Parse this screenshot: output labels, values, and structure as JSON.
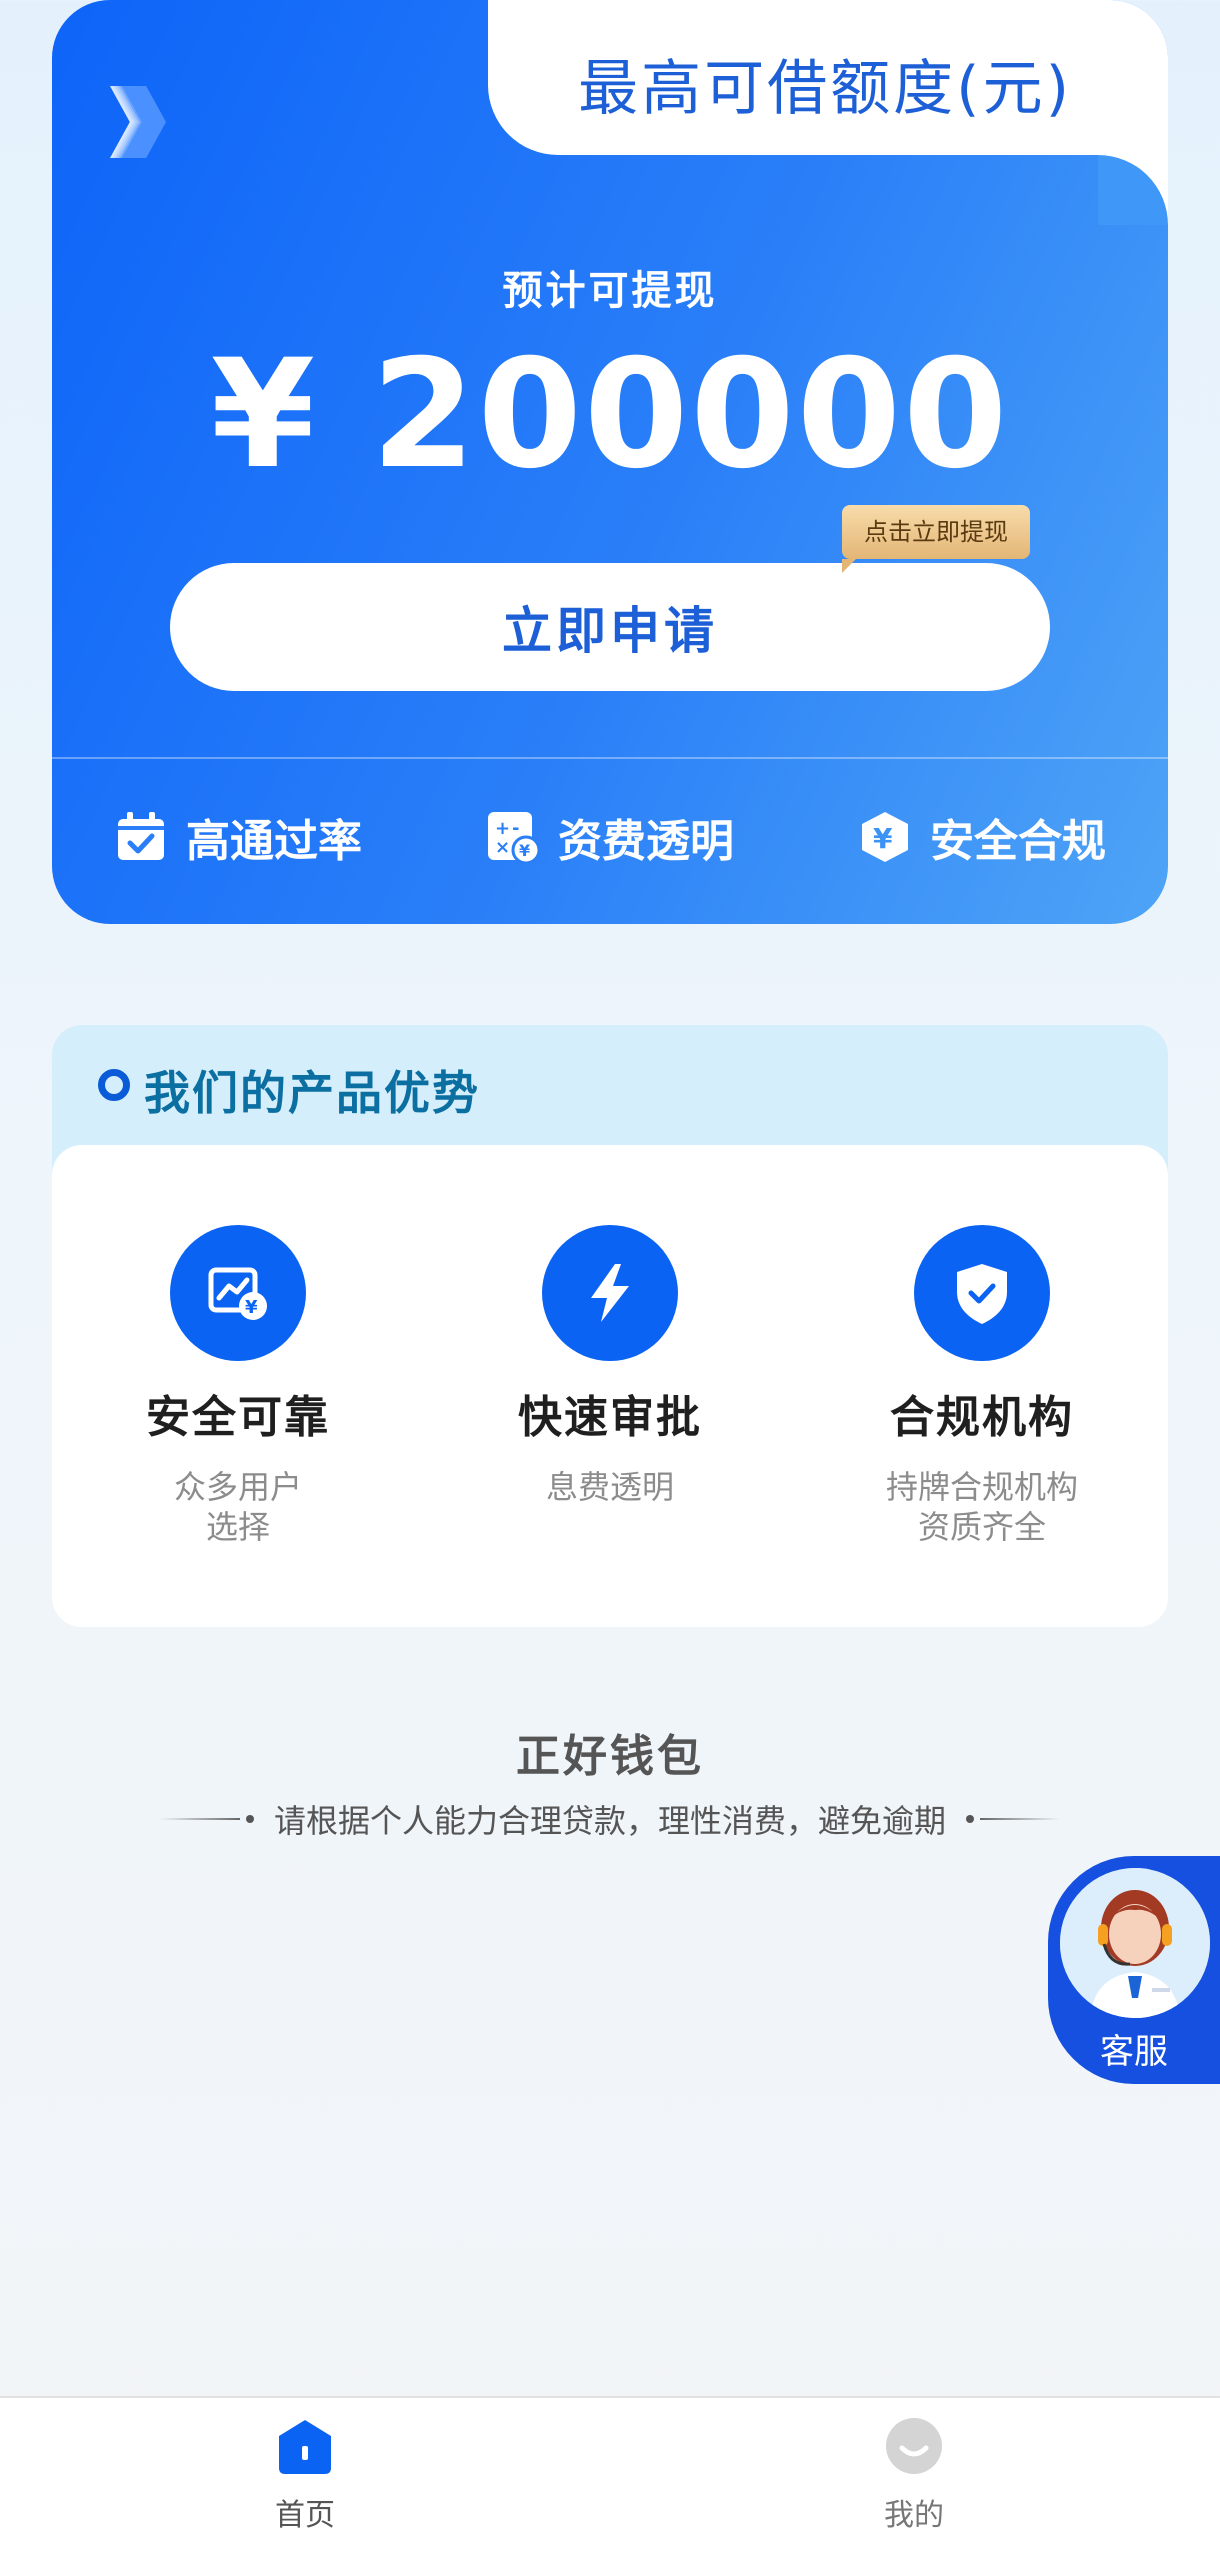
{
  "hero": {
    "title": "最高可借额度(元)",
    "subtitle": "预计可提现",
    "amount": "¥ 200000",
    "tip": "点击立即提现",
    "apply_label": "立即申请",
    "features": [
      {
        "icon": "calendar-check-icon",
        "label": "高通过率"
      },
      {
        "icon": "fee-calculator-icon",
        "label": "资费透明"
      },
      {
        "icon": "yuan-shield-icon",
        "label": "安全合规"
      }
    ],
    "colors": {
      "primary": "#0d64f8",
      "accent": "#1d5fd6"
    }
  },
  "advantages": {
    "title": "我们的产品优势",
    "items": [
      {
        "icon": "chart-yuan-icon",
        "name": "安全可靠",
        "desc": "众多用户\n选择"
      },
      {
        "icon": "lightning-icon",
        "name": "快速审批",
        "desc": "息费透明"
      },
      {
        "icon": "shield-check-icon",
        "name": "合规机构",
        "desc": "持牌合规机构\n资质齐全"
      }
    ]
  },
  "footer": {
    "brand": "正好钱包",
    "slogan": "请根据个人能力合理贷款，理性消费，避免逾期"
  },
  "customer_service": {
    "label": "客服"
  },
  "nav": {
    "home_label": "首页",
    "mine_label": "我的"
  }
}
